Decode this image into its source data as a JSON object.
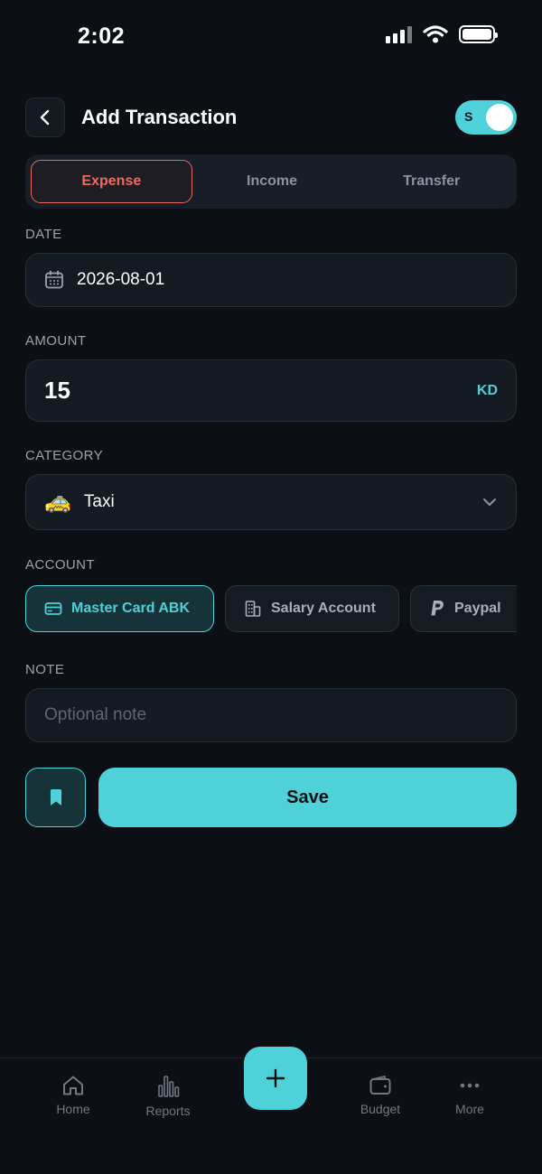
{
  "status_bar": {
    "time": "2:02"
  },
  "header": {
    "title": "Add Transaction",
    "toggle_letter": "S"
  },
  "tabs": [
    {
      "label": "Expense",
      "active": true
    },
    {
      "label": "Income",
      "active": false
    },
    {
      "label": "Transfer",
      "active": false
    }
  ],
  "date": {
    "label": "DATE",
    "value": "2026-08-01"
  },
  "amount": {
    "label": "AMOUNT",
    "value": "15",
    "currency": "KD"
  },
  "category": {
    "label": "CATEGORY",
    "emoji": "🚕",
    "value": "Taxi"
  },
  "account": {
    "label": "ACCOUNT",
    "options": [
      {
        "label": "Master Card ABK",
        "icon": "credit-card-icon",
        "active": true
      },
      {
        "label": "Salary Account",
        "icon": "building-icon",
        "active": false
      },
      {
        "label": "Paypal",
        "icon": "paypal-icon",
        "active": false
      }
    ]
  },
  "note": {
    "label": "NOTE",
    "placeholder": "Optional note",
    "value": ""
  },
  "actions": {
    "save_label": "Save"
  },
  "bottom_nav": [
    {
      "label": "Home",
      "icon": "home-icon"
    },
    {
      "label": "Reports",
      "icon": "bar-chart-icon"
    },
    {
      "label": "Budget",
      "icon": "wallet-icon"
    },
    {
      "label": "More",
      "icon": "more-icon"
    }
  ],
  "colors": {
    "accent": "#4fd1d9",
    "expense": "#ef6a5d",
    "background": "#0c0f14"
  }
}
